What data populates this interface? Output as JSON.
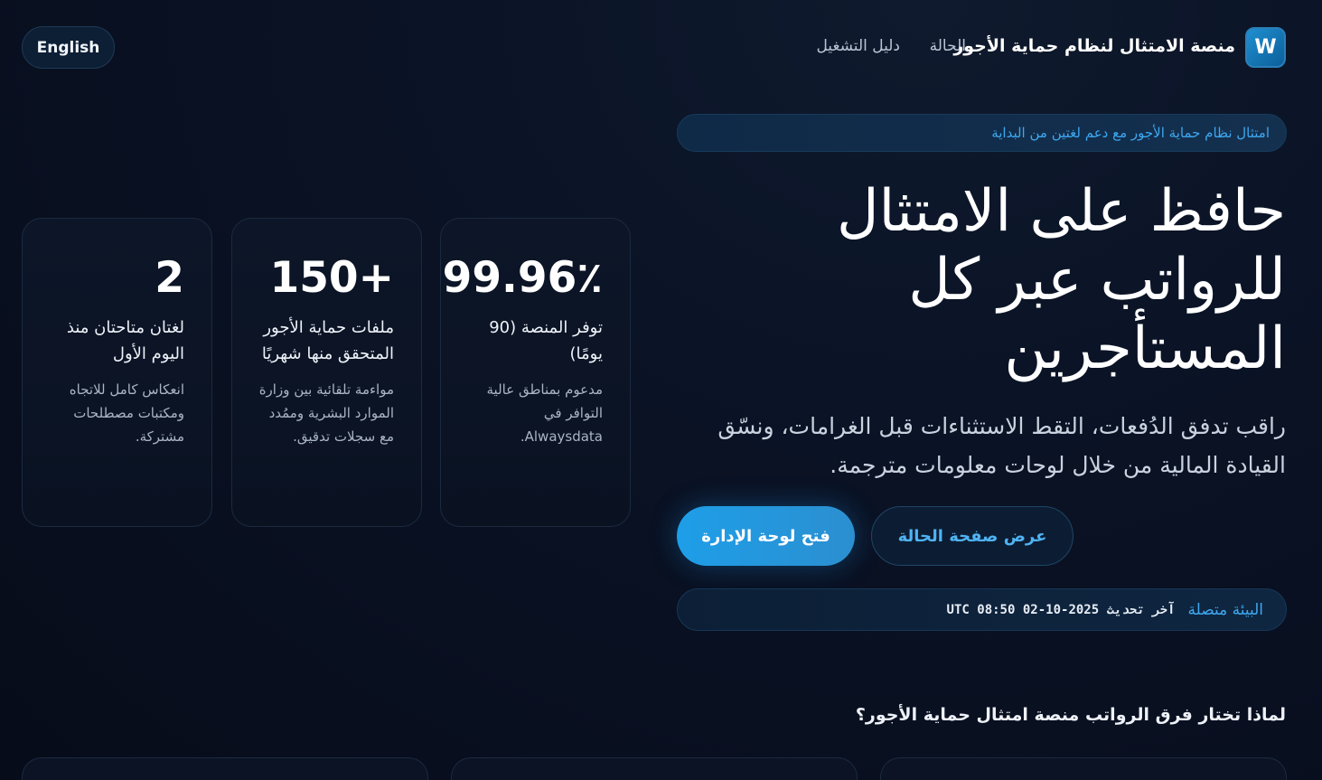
{
  "header": {
    "language_button": "English",
    "logo_letter": "W",
    "brand_name": "منصة الامتثال لنظام حماية الأجور",
    "nav": {
      "status": "الحالة",
      "guide": "دليل التشغيل"
    }
  },
  "hero": {
    "badge": "امتثال نظام حماية الأجور مع دعم لغتين من البداية",
    "title": "حافظ على الامتثال للرواتب عبر كل المستأجرين",
    "subtitle": "راقب تدفق الدُفعات، التقط الاستثناءات قبل الغرامات، ونسّق القيادة المالية من خلال لوحات معلومات مترجمة.",
    "primary_button": "فتح لوحة الإدارة",
    "secondary_button": "عرض صفحة الحالة",
    "environment": {
      "status": "البيئة متصلة",
      "last_update": "آخر تحديث 2025-10-02 08:50 UTC"
    }
  },
  "stats": [
    {
      "value": "99.96٪",
      "label": "توفر المنصة (90 يومًا)",
      "description": "مدعوم بمناطق عالية التوافر في Alwaysdata."
    },
    {
      "value": "+150",
      "label": "ملفات حماية الأجور المتحقق منها شهريًا",
      "description": "مواءمة تلقائية بين وزارة الموارد البشرية وممُدد مع سجلات تدقيق."
    },
    {
      "value": "2",
      "label": "لغتان متاحتان منذ اليوم الأول",
      "description": "انعكاس كامل للاتجاه ومكتبات مصطلحات مشتركة."
    }
  ],
  "why": {
    "title": "لماذا تختار فرق الرواتب منصة امتثال حماية الأجور؟"
  },
  "colors": {
    "accent": "#3ea8f0",
    "primary_button": "#1e9ee8",
    "background": "#0a1224"
  }
}
